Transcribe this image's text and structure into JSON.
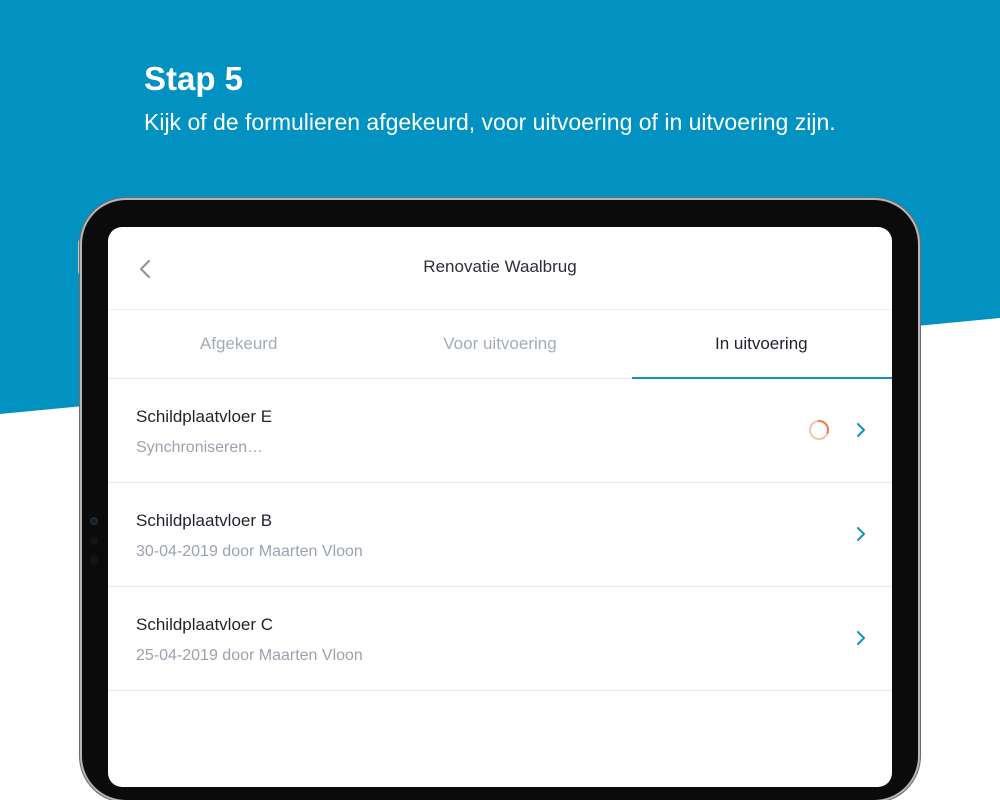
{
  "promo": {
    "heading": "Stap 5",
    "subtitle": "Kijk of de formulieren afgekeurd, voor uitvoering of in uitvoering zijn."
  },
  "colors": {
    "brand_blue": "#0192c2",
    "accent_teal": "#1192bd",
    "spinner_orange": "#f37a4c"
  },
  "app": {
    "nav": {
      "back_icon": "chevron-left-icon",
      "title": "Renovatie Waalbrug"
    },
    "tabs": [
      {
        "label": "Afgekeurd",
        "active": false
      },
      {
        "label": "Voor uitvoering",
        "active": false
      },
      {
        "label": "In uitvoering",
        "active": true
      }
    ],
    "forms": [
      {
        "title": "Schildplaatvloer E",
        "subtitle": "Synchroniseren…",
        "syncing": true
      },
      {
        "title": "Schildplaatvloer B",
        "subtitle": "30-04-2019 door Maarten Vloon",
        "syncing": false
      },
      {
        "title": "Schildplaatvloer C",
        "subtitle": "25-04-2019 door Maarten Vloon",
        "syncing": false
      }
    ]
  }
}
